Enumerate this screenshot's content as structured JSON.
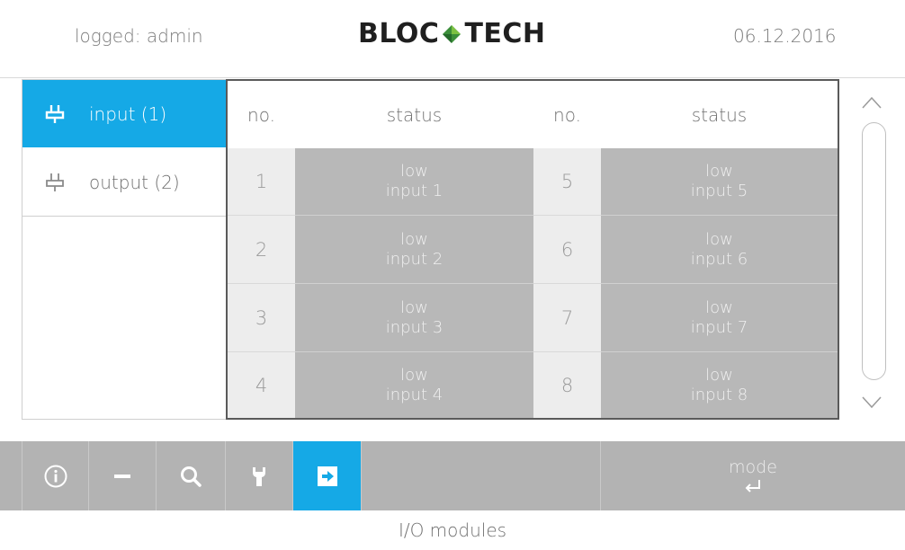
{
  "header": {
    "user_label": "logged: admin",
    "logo_left": "BLOC",
    "logo_right": "TECH",
    "date": "06.12.2016"
  },
  "sidebar": {
    "items": [
      {
        "label": "input (1)",
        "icon": "plug-icon",
        "active": true
      },
      {
        "label": "output (2)",
        "icon": "plug-icon",
        "active": false
      }
    ]
  },
  "table": {
    "headers": [
      "no.",
      "status",
      "no.",
      "status"
    ],
    "rows": [
      {
        "left_no": "1",
        "left_state": "low",
        "left_name": "input 1",
        "right_no": "5",
        "right_state": "low",
        "right_name": "input 5"
      },
      {
        "left_no": "2",
        "left_state": "low",
        "left_name": "input 2",
        "right_no": "6",
        "right_state": "low",
        "right_name": "input 6"
      },
      {
        "left_no": "3",
        "left_state": "low",
        "left_name": "input 3",
        "right_no": "7",
        "right_state": "low",
        "right_name": "input 7"
      },
      {
        "left_no": "4",
        "left_state": "low",
        "left_name": "input 4",
        "right_no": "8",
        "right_state": "low",
        "right_name": "input 8"
      }
    ]
  },
  "toolbar": {
    "tools": [
      "info-icon",
      "minus-icon",
      "search-icon",
      "wrench-icon",
      "arrow-right-icon"
    ],
    "active_tool": "arrow-right-icon",
    "mode_label": "mode",
    "mode_icon": "enter-return-icon"
  },
  "footer": {
    "title": "I/O modules"
  },
  "colors": {
    "accent": "#15a9e6",
    "toolbar": "#b3b3b3",
    "status_cell": "#b8b8b8",
    "number_cell": "#ededed"
  }
}
